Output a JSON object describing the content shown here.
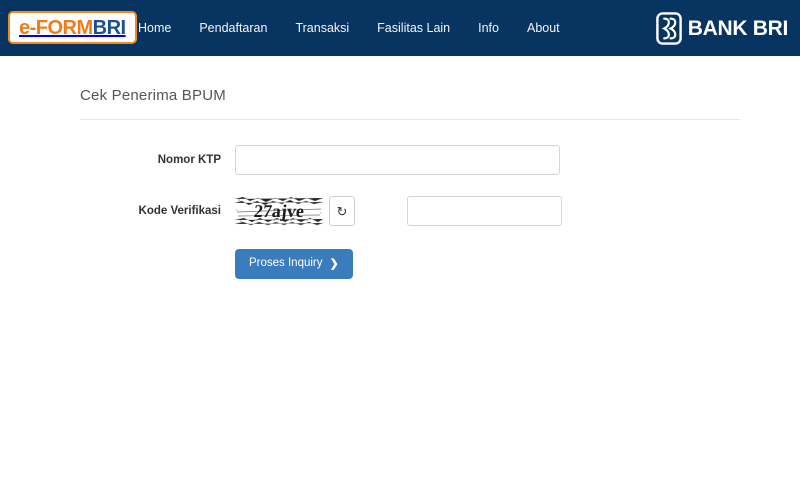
{
  "navbar": {
    "logo": {
      "part1": "e-FORM",
      "part2": "BRI"
    },
    "links": [
      {
        "label": "Home",
        "name": "nav-link-home"
      },
      {
        "label": "Pendaftaran",
        "name": "nav-link-pendaftaran"
      },
      {
        "label": "Transaksi",
        "name": "nav-link-transaksi"
      },
      {
        "label": "Fasilitas Lain",
        "name": "nav-link-fasilitas-lain"
      },
      {
        "label": "Info",
        "name": "nav-link-info"
      },
      {
        "label": "About",
        "name": "nav-link-about"
      }
    ],
    "bank_brand": "BANK BRI"
  },
  "page": {
    "title": "Cek Penerima BPUM"
  },
  "form": {
    "ktp": {
      "label": "Nomor KTP",
      "value": "",
      "placeholder": ""
    },
    "kode_verifikasi": {
      "label": "Kode Verifikasi",
      "captcha_text": "27ajve",
      "refresh_label": "↻",
      "value": "",
      "placeholder": ""
    },
    "submit": {
      "label": "Proses Inquiry",
      "chevron": "❯"
    }
  },
  "colors": {
    "navbar_navy": "#083461",
    "logo_orange": "#ef7c18",
    "logo_blue": "#1a4f9c",
    "button_blue": "#3b7cbe",
    "input_border": "#d4d4d4",
    "rule_gray": "#e7e7e7"
  }
}
